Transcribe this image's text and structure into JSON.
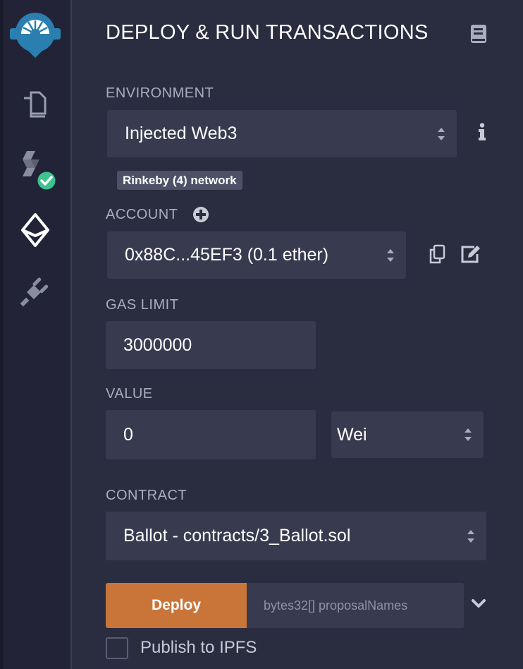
{
  "panel": {
    "title": "DEPLOY & RUN TRANSACTIONS"
  },
  "environment": {
    "label": "ENVIRONMENT",
    "value": "Injected Web3",
    "network_badge": "Rinkeby (4) network"
  },
  "account": {
    "label": "ACCOUNT",
    "value": "0x88C...45EF3 (0.1 ether)"
  },
  "gas_limit": {
    "label": "GAS LIMIT",
    "value": "3000000"
  },
  "value": {
    "label": "VALUE",
    "amount": "0",
    "unit": "Wei"
  },
  "contract": {
    "label": "CONTRACT",
    "value": "Ballot - contracts/3_Ballot.sol"
  },
  "deploy": {
    "button_label": "Deploy",
    "args_placeholder": "bytes32[] proposalNames"
  },
  "publish": {
    "label": "Publish to IPFS",
    "checked": false
  },
  "colors": {
    "accent": "#c97539",
    "remix_blue": "#2a7fb0",
    "success_green": "#3ec28f"
  },
  "icons": [
    "remix-logo-icon",
    "file-explorer-icon",
    "solidity-compiler-icon",
    "check-circle-icon",
    "ethereum-deploy-icon",
    "plugin-icon",
    "book-icon",
    "info-icon",
    "plus-circle-icon",
    "copy-icon",
    "edit-icon",
    "chevron-down-icon"
  ]
}
